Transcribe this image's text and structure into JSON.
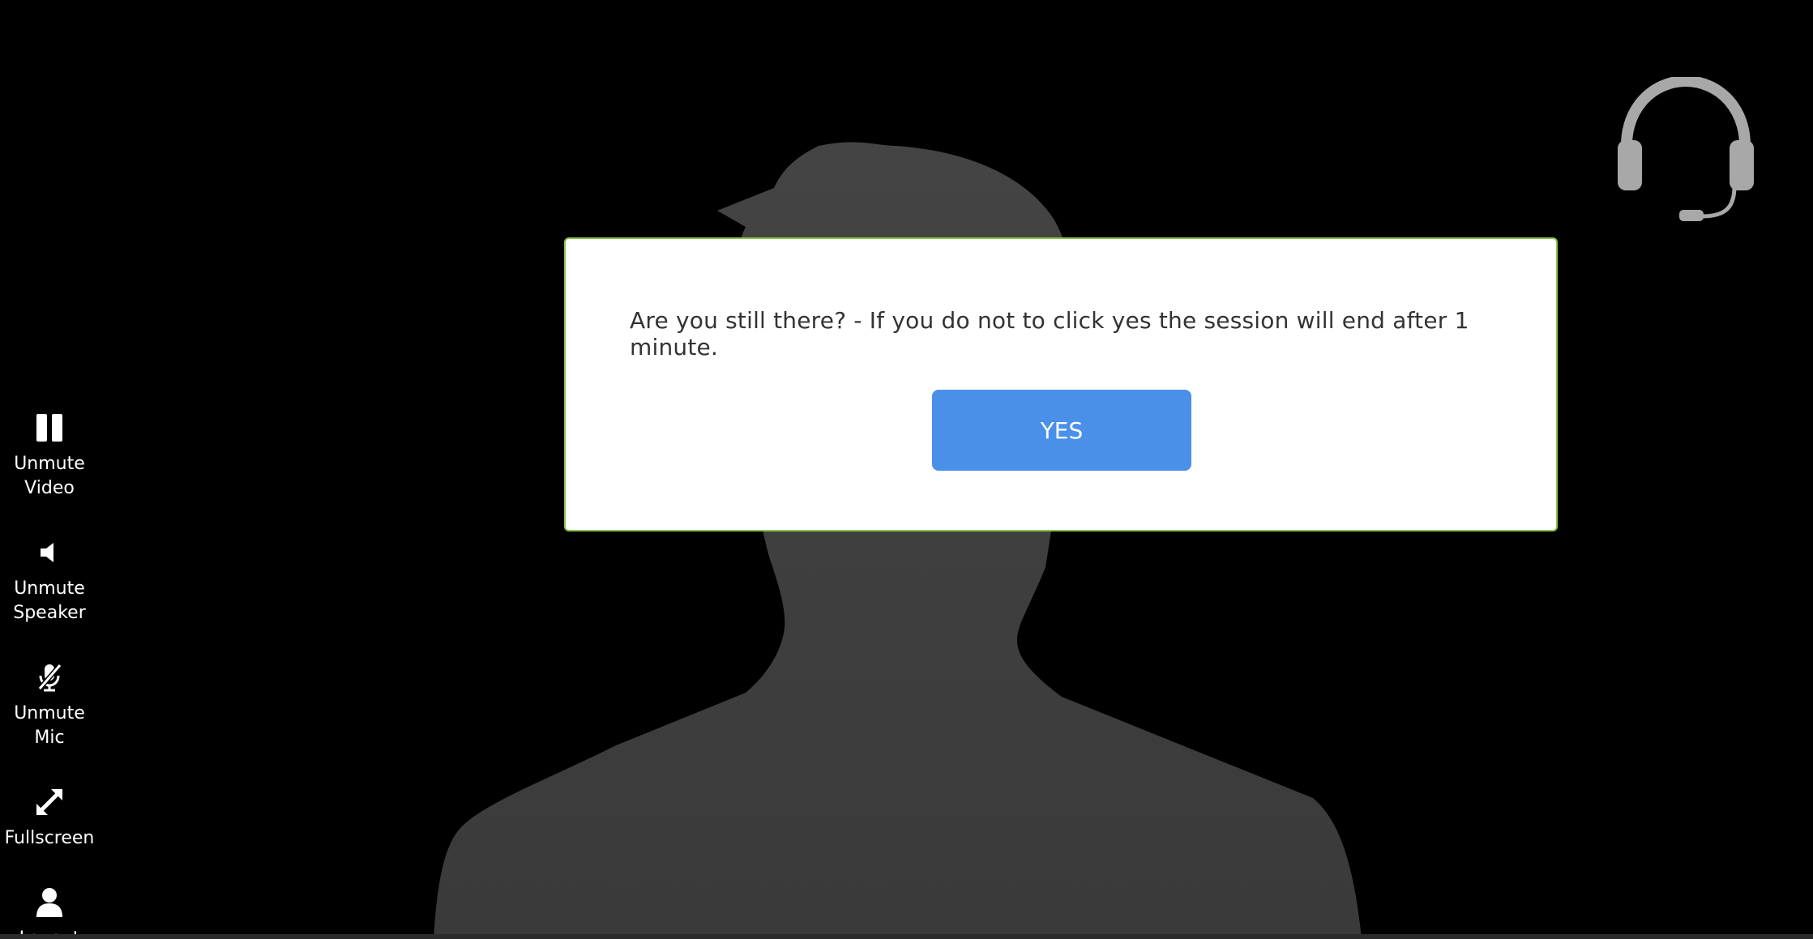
{
  "modal": {
    "message": "Are you still there? - If you do not to click yes the session will end after 1 minute.",
    "yes_label": "YES"
  },
  "sidebar": {
    "items": [
      {
        "label": "Unmute\nVideo",
        "icon": "pause-icon"
      },
      {
        "label": "Unmute\nSpeaker",
        "icon": "speaker-icon"
      },
      {
        "label": "Unmute\nMic",
        "icon": "mic-muted-icon"
      },
      {
        "label": "Fullscreen",
        "icon": "fullscreen-icon"
      },
      {
        "label": "Layout",
        "icon": "person-icon"
      }
    ]
  },
  "colors": {
    "background": "#000000",
    "silhouette": "#404040",
    "modal_border": "#8bc34a",
    "button": "#4a90e8",
    "headset": "#a8a8a8"
  }
}
